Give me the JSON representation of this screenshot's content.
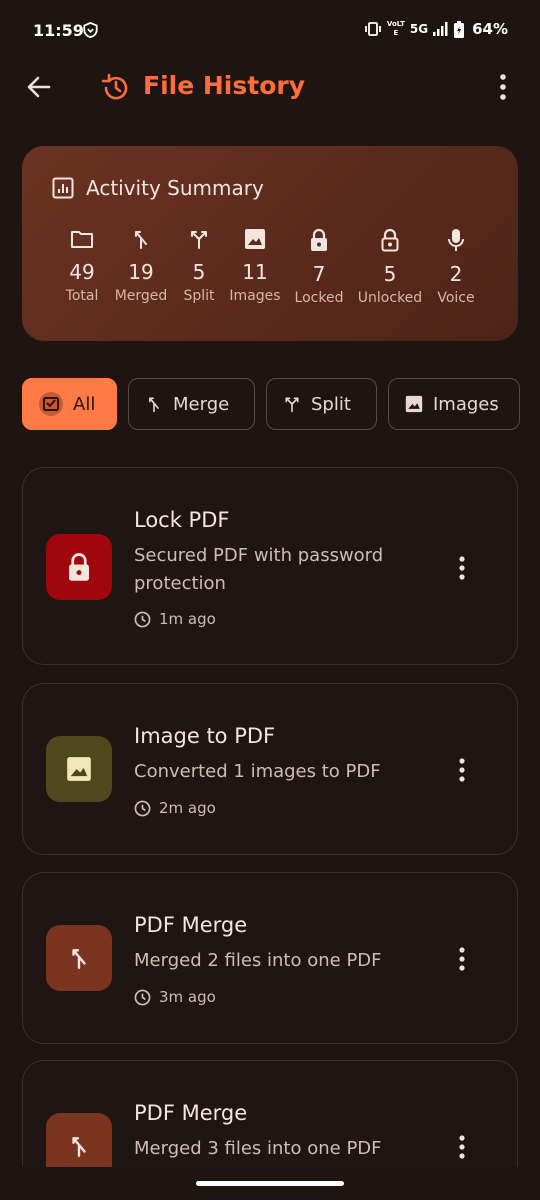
{
  "status_bar": {
    "time": "11:59",
    "network_top": "VoLTE",
    "network_5g": "5G",
    "battery": "64%"
  },
  "app_bar": {
    "title": "File History",
    "back_icon": "arrow-back-icon",
    "title_icon": "history-icon",
    "menu_icon": "more-vert-icon"
  },
  "summary": {
    "title": "Activity Summary",
    "stats": [
      {
        "icon": "folder-icon",
        "value": "49",
        "label": "Total"
      },
      {
        "icon": "merge-icon",
        "value": "19",
        "label": "Merged"
      },
      {
        "icon": "split-icon",
        "value": "5",
        "label": "Split"
      },
      {
        "icon": "image-icon",
        "value": "11",
        "label": "Images"
      },
      {
        "icon": "lock-icon",
        "value": "7",
        "label": "Locked"
      },
      {
        "icon": "unlock-icon",
        "value": "5",
        "label": "Unlocked"
      },
      {
        "icon": "mic-icon",
        "value": "2",
        "label": "Voice"
      }
    ]
  },
  "filters": [
    {
      "label": "All",
      "active": true
    },
    {
      "label": "Merge",
      "active": false
    },
    {
      "label": "Split",
      "active": false
    },
    {
      "label": "Images",
      "active": false
    }
  ],
  "history": [
    {
      "title": "Lock PDF",
      "desc": "Secured PDF with password protection",
      "time": "1m ago",
      "icon": "lock-icon",
      "color": "#a1060c"
    },
    {
      "title": "Image to PDF",
      "desc": "Converted 1 images to PDF",
      "time": "2m ago",
      "icon": "image-icon",
      "color": "#4f4a1e"
    },
    {
      "title": "PDF Merge",
      "desc": "Merged 2 files into one PDF",
      "time": "3m ago",
      "icon": "merge-icon",
      "color": "#7a3420"
    },
    {
      "title": "PDF Merge",
      "desc": "Merged 3 files into one PDF",
      "time": "",
      "icon": "merge-icon",
      "color": "#7a3420"
    }
  ],
  "colors": {
    "accent": "#ff6e3a",
    "background": "#1e1513",
    "chip_active": "#ff7a45"
  }
}
